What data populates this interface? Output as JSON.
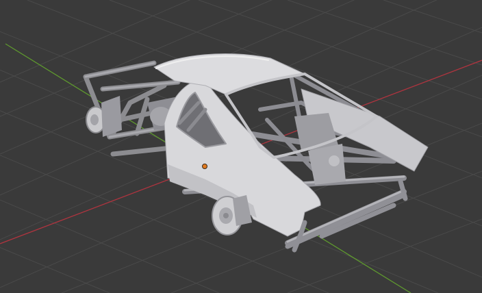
{
  "app": {
    "name": ""
  },
  "viewport": {
    "mode": "solid",
    "background_color": "#3a3a3a",
    "grid_color": "#4a4a4a",
    "x_axis_color": "#b0343f",
    "y_axis_color": "#5f9a2e",
    "origin_marker_color": "#e07a20"
  },
  "scene": {
    "object": "car-body-with-roll-cage",
    "icons": [
      "origin-marker-icon"
    ]
  }
}
